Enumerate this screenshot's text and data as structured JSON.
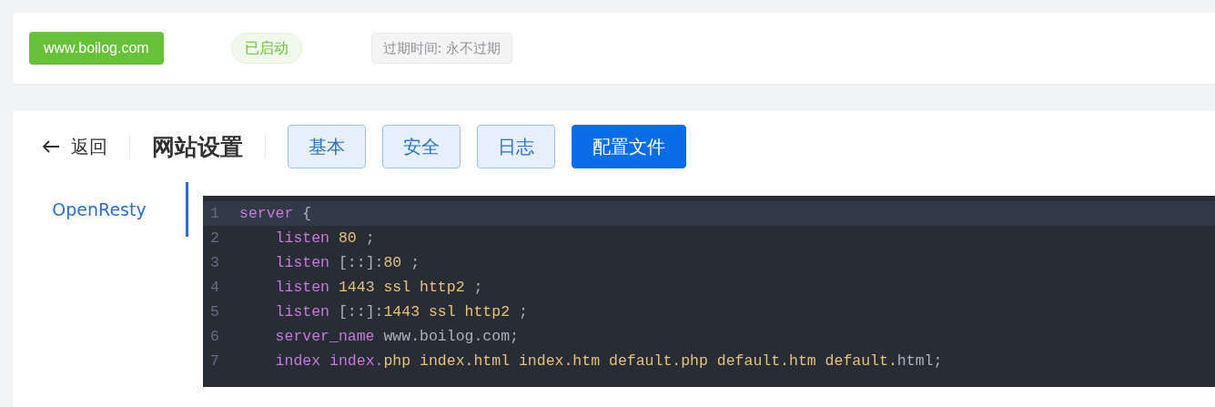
{
  "site_bar": {
    "domain": "www.boilog.com",
    "status": "已启动",
    "expiry": "过期时间: 永不过期"
  },
  "header": {
    "back": "返回",
    "title": "网站设置",
    "tabs": [
      {
        "label": "基本",
        "selected": false
      },
      {
        "label": "安全",
        "selected": false
      },
      {
        "label": "日志",
        "selected": false
      },
      {
        "label": "配置文件",
        "selected": true
      }
    ]
  },
  "side_menu": [
    {
      "label": "OpenResty",
      "selected": true
    }
  ],
  "editor": {
    "lines": [
      {
        "number": "1",
        "highlighted": true,
        "tokens": [
          {
            "text": "server",
            "kind": "keyword"
          },
          {
            "text": " {",
            "kind": "plain"
          }
        ]
      },
      {
        "number": "2",
        "highlighted": false,
        "tokens": [
          {
            "text": "    listen",
            "kind": "keyword"
          },
          {
            "text": " 80",
            "kind": "value"
          },
          {
            "text": " ;",
            "kind": "plain"
          }
        ]
      },
      {
        "number": "3",
        "highlighted": false,
        "tokens": [
          {
            "text": "    listen",
            "kind": "keyword"
          },
          {
            "text": " [::]:",
            "kind": "plain"
          },
          {
            "text": "80",
            "kind": "value"
          },
          {
            "text": " ;",
            "kind": "plain"
          }
        ]
      },
      {
        "number": "4",
        "highlighted": false,
        "tokens": [
          {
            "text": "    listen",
            "kind": "keyword"
          },
          {
            "text": " 1443 ssl http2",
            "kind": "value"
          },
          {
            "text": " ;",
            "kind": "plain"
          }
        ]
      },
      {
        "number": "5",
        "highlighted": false,
        "tokens": [
          {
            "text": "    listen",
            "kind": "keyword"
          },
          {
            "text": " [::]:",
            "kind": "plain"
          },
          {
            "text": "1443 ssl http2",
            "kind": "value"
          },
          {
            "text": " ;",
            "kind": "plain"
          }
        ]
      },
      {
        "number": "6",
        "highlighted": false,
        "tokens": [
          {
            "text": "    server_name",
            "kind": "keyword"
          },
          {
            "text": " www.boilog.com;",
            "kind": "plain"
          }
        ]
      },
      {
        "number": "7",
        "highlighted": false,
        "tokens": [
          {
            "text": "    index",
            "kind": "keyword"
          },
          {
            "text": " index.",
            "kind": "keyword"
          },
          {
            "text": "php index.html index.htm default.php default.htm default.",
            "kind": "value"
          },
          {
            "text": "html;",
            "kind": "plain"
          }
        ]
      }
    ]
  }
}
